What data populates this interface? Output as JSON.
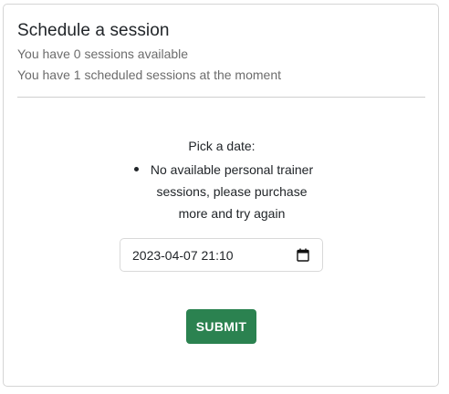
{
  "card": {
    "title": "Schedule a session",
    "info_lines": [
      "You have 0 sessions available",
      "You have 1 scheduled sessions at the moment"
    ]
  },
  "form": {
    "pick_label": "Pick a date:",
    "messages": [
      "No available personal trainer sessions, please purchase more and try again"
    ],
    "date_value": "2023-04-07 21:10",
    "calendar_icon": "calendar-icon",
    "submit_label": "SUBMIT"
  },
  "colors": {
    "submit_bg": "#2b8250",
    "muted_text": "#6c6c6c",
    "border": "#d5d5d5"
  }
}
